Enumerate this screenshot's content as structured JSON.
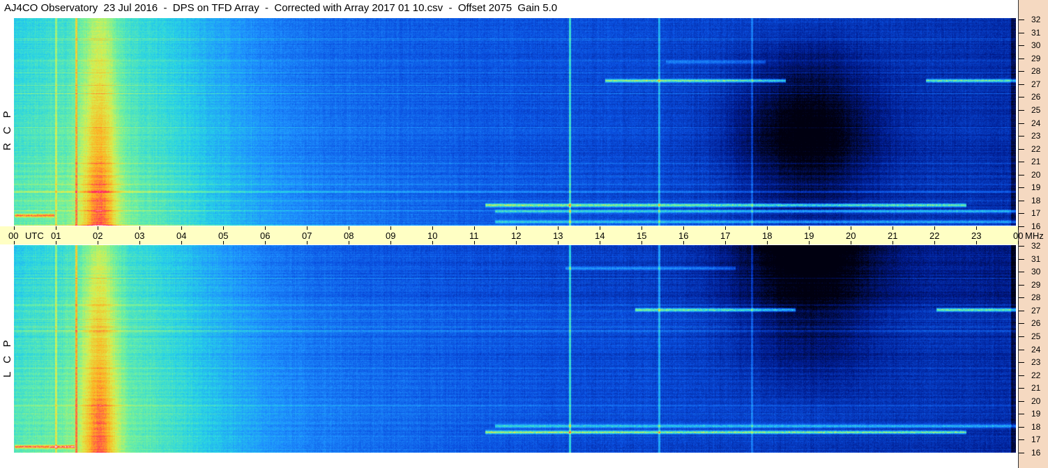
{
  "title": "AJ4CO Observatory  23 Jul 2016  -  DPS on TFD Array  -  Corrected with Array 2017 01 10.csv  -  Offset 2075  Gain 5.0",
  "panels": [
    {
      "id": "rcp",
      "label": "R   C   P"
    },
    {
      "id": "lcp",
      "label": "L   C   P"
    }
  ],
  "time_axis": {
    "labels": [
      "00",
      "01",
      "02",
      "03",
      "04",
      "05",
      "06",
      "07",
      "08",
      "09",
      "10",
      "11",
      "12",
      "13",
      "14",
      "15",
      "16",
      "17",
      "18",
      "19",
      "20",
      "21",
      "22",
      "23",
      "00"
    ],
    "unit_label": "UTC",
    "freq_unit": "MHz"
  },
  "freq_axis": {
    "labels": [
      "32",
      "31",
      "30",
      "29",
      "28",
      "27",
      "26",
      "25",
      "24",
      "23",
      "22",
      "21",
      "20",
      "19",
      "18",
      "17",
      "16"
    ]
  },
  "chart_data": {
    "type": "heatmap",
    "title": "AJ4CO Observatory  23 Jul 2016  -  DPS on TFD Array  -  Corrected with Array 2017 01 10.csv  -  Offset 2075  Gain 5.0",
    "x": {
      "label": "UTC",
      "range": [
        0,
        24
      ],
      "ticks": [
        "00",
        "01",
        "02",
        "03",
        "04",
        "05",
        "06",
        "07",
        "08",
        "09",
        "10",
        "11",
        "12",
        "13",
        "14",
        "15",
        "16",
        "17",
        "18",
        "19",
        "20",
        "21",
        "22",
        "23",
        "00"
      ]
    },
    "y": {
      "label": "MHz",
      "range": [
        16,
        32
      ],
      "ticks": [
        "16",
        "17",
        "18",
        "19",
        "20",
        "21",
        "22",
        "23",
        "24",
        "25",
        "26",
        "27",
        "28",
        "29",
        "30",
        "31",
        "32"
      ]
    },
    "series": [
      {
        "name": "R C P"
      },
      {
        "name": "L C P"
      }
    ],
    "colormap": [
      "#000010",
      "#001a8c",
      "#0a4fe0",
      "#1e90ff",
      "#27d3e6",
      "#6ff0a0",
      "#d8f050",
      "#ffb020",
      "#ff2060",
      "#ffffff"
    ]
  }
}
